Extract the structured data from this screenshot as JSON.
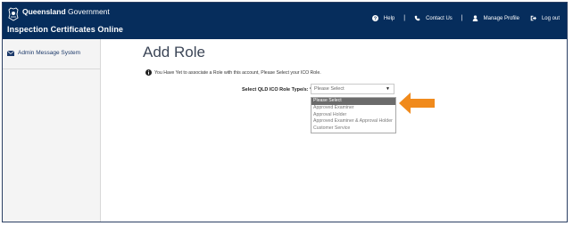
{
  "header": {
    "brand_bold": "Queensland",
    "brand_regular": " Government",
    "app_title": "Inspection Certificates Online",
    "nav": {
      "help": "Help",
      "contact": "Contact Us",
      "profile": "Manage Profile",
      "logout": "Log out",
      "separator": "|"
    }
  },
  "sidebar": {
    "items": [
      {
        "label": "Admin Message System",
        "icon": "envelope-icon"
      }
    ]
  },
  "main": {
    "title": "Add Role",
    "notice": "You Have Yet to associate a Role with this account, Please Select your ICO Role.",
    "field_label": "Select QLD ICO Role Type/s: *",
    "select_value": "Please Select",
    "options": [
      "Please Select",
      "Approved Examiner",
      "Approval Holder",
      "Approved Examiner & Approval Holder",
      "Customer Service"
    ],
    "selected_index": 0
  },
  "colors": {
    "header_bg": "#062d5c",
    "sidebar_bg": "#f4f4f4",
    "selected_option_bg": "#6b6b6b",
    "annotation_arrow": "#f08a1c"
  }
}
